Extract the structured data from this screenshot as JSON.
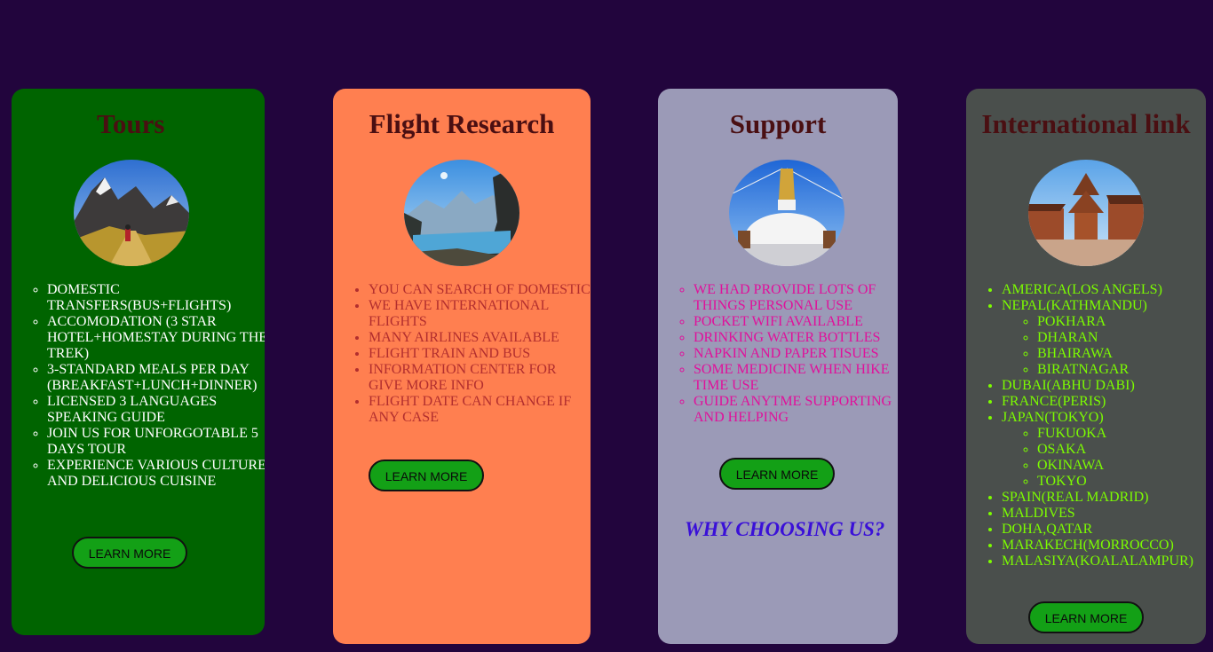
{
  "cards": {
    "tours": {
      "title": "Tours",
      "items": [
        "DOMESTIC TRANSFERS(BUS+FLIGHTS)",
        "ACCOMODATION (3 STAR HOTEL+HOMESTAY DURING THE TREK)",
        "3-STANDARD MEALS PER DAY (BREAKFAST+LUNCH+DINNER)",
        "LICENSED 3 LANGUAGES SPEAKING GUIDE",
        "JOIN US FOR UNFORGOTABLE 5 DAYS TOUR",
        "EXPERIENCE VARIOUS CULTURE AND DELICIOUS CUISINE"
      ],
      "button": "LEARN MORE"
    },
    "flight": {
      "title": "Flight Research",
      "items": [
        "YOU CAN SEARCH OF DOMESTIC",
        "WE HAVE INTERNATIONAL FLIGHTS",
        "MANY AIRLINES AVAILABLE",
        "FLIGHT TRAIN AND BUS",
        "INFORMATION CENTER FOR GIVE MORE INFO",
        "FLIGHT DATE CAN CHANGE IF ANY CASE"
      ],
      "button": "LEARN MORE"
    },
    "support": {
      "title": "Support",
      "items": [
        "WE HAD PROVIDE LOTS OF THINGS PERSONAL USE",
        "POCKET WIFI AVAILABLE",
        "DRINKING WATER BOTTLES",
        "NAPKIN AND PAPER TISUES",
        "SOME MEDICINE WHEN HIKE TIME USE",
        "GUIDE ANYTME SUPPORTING AND HELPING"
      ],
      "button": "LEARN MORE",
      "why": "WHY CHOOSING US?"
    },
    "intl": {
      "title": "International link",
      "items": [
        {
          "label": "AMERICA(LOS ANGELS)",
          "sub": []
        },
        {
          "label": "NEPAL(KATHMANDU)",
          "sub": [
            "POKHARA",
            "DHARAN",
            "BHAIRAWA",
            "BIRATNAGAR"
          ]
        },
        {
          "label": "DUBAI(ABHU DABI)",
          "sub": []
        },
        {
          "label": "FRANCE(PERIS)",
          "sub": []
        },
        {
          "label": "JAPAN(TOKYO)",
          "sub": [
            "FUKUOKA",
            "OSAKA",
            "OKINAWA",
            "TOKYO"
          ]
        },
        {
          "label": "SPAIN(REAL MADRID)",
          "sub": []
        },
        {
          "label": "MALDIVES",
          "sub": []
        },
        {
          "label": "DOHA,QATAR",
          "sub": []
        },
        {
          "label": "MARAKECH(MORROCCO)",
          "sub": []
        },
        {
          "label": "MALASIYA(KOALALAMPUR)",
          "sub": []
        }
      ],
      "button": "LEARN MORE"
    }
  },
  "colors": {
    "page_bg": "#22053d",
    "tours_bg": "#006400",
    "flight_bg": "#ff7f50",
    "support_bg": "#9b9ab7",
    "intl_bg": "#4a4f4c",
    "button_bg": "#13a016",
    "title": "#4a0f12"
  }
}
